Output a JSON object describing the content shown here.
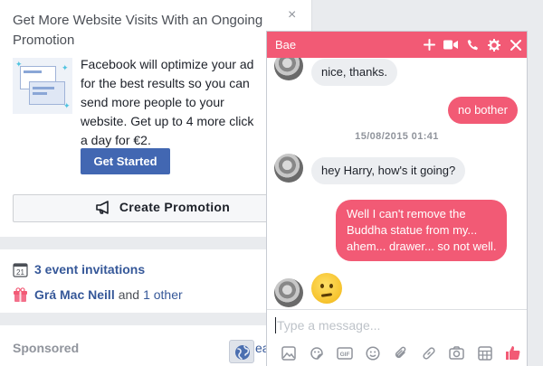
{
  "promo": {
    "title": "Get More Website Visits With an Ongoing Promotion",
    "close": "×",
    "body_lines": [
      "Facebook will optimize your ad",
      "for the best results so you can",
      "send more people to your",
      "website. Get up to 4 more click",
      "a day for €2."
    ],
    "get_started": "Get Started",
    "create_promotion": "Create Promotion"
  },
  "events": {
    "invitations": "3 event invitations",
    "calendar_day": "21",
    "birthday_name": "Grá Mac Neill",
    "and": "and",
    "others": "1 other"
  },
  "sponsored": {
    "label": "Sponsored",
    "cut_text": "ea"
  },
  "chat": {
    "title": "Bae",
    "accent": "#f25a75",
    "header_icons": [
      "plus-icon",
      "video-camera-icon",
      "phone-icon",
      "gear-icon",
      "close-icon"
    ],
    "messages": [
      {
        "from": "them",
        "text": "nice, thanks."
      },
      {
        "from": "me",
        "text": "no bother"
      },
      {
        "timestamp": "15/08/2015 01:41"
      },
      {
        "from": "them",
        "text": "hey Harry, how's it going?"
      },
      {
        "from": "me",
        "lines": [
          "Well I can't remove the",
          "Buddha statue from my...",
          "ahem... drawer... so not well."
        ]
      },
      {
        "from": "them",
        "emoji": "confused-face"
      }
    ],
    "compose_placeholder": "Type a message...",
    "toolbar_icons": [
      "photo-icon",
      "sticker-icon",
      "gif-icon",
      "emoji-icon",
      "attachment-icon",
      "link-icon",
      "camera-icon",
      "table-icon",
      "thumbs-up-icon"
    ],
    "gif_label": "GIF"
  }
}
